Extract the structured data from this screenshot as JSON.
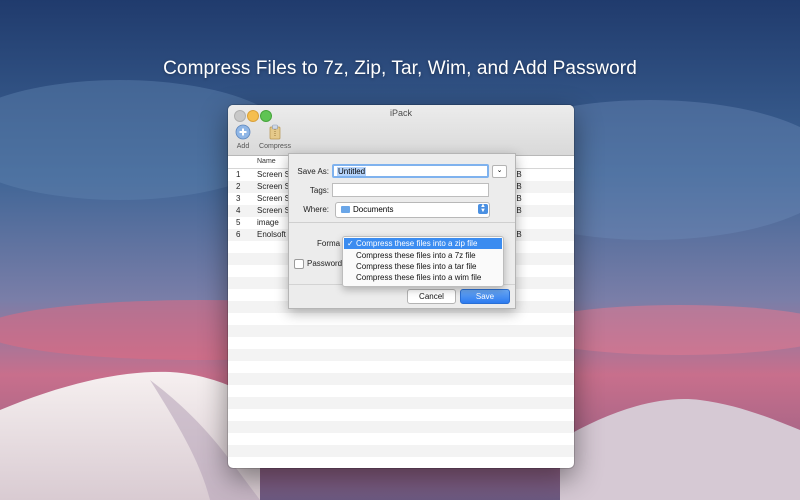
{
  "headline": "Compress Files to 7z, Zip, Tar, Wim, and Add Password",
  "window": {
    "title": "iPack",
    "toolbar": {
      "add_label": "Add",
      "compress_label": "Compress"
    },
    "list": {
      "column_name": "Name",
      "rows": [
        {
          "index": "1",
          "name": "Screen S",
          "size": "KB"
        },
        {
          "index": "2",
          "name": "Screen S",
          "size": "KB"
        },
        {
          "index": "3",
          "name": "Screen S",
          "size": "KB"
        },
        {
          "index": "4",
          "name": "Screen S",
          "size": "KB"
        },
        {
          "index": "5",
          "name": "image",
          "size": ""
        },
        {
          "index": "6",
          "name": "Enolsoft",
          "size": "KB"
        }
      ]
    }
  },
  "save_dialog": {
    "save_as_label": "Save As:",
    "save_as_value": "Untitled",
    "tags_label": "Tags:",
    "tags_value": "",
    "where_label": "Where:",
    "where_value": "Documents",
    "format_label": "Forma",
    "password_label": "Password",
    "cancel_label": "Cancel",
    "save_label": "Save"
  },
  "format_menu": {
    "selected_index": 0,
    "check_glyph": "✓",
    "options": [
      "Compress these files into a zip file",
      "Compress these files into a 7z file",
      "Compress these files into a tar file",
      "Compress these files into a wim file"
    ]
  },
  "colors": {
    "accent": "#3b8cf0",
    "sky_top": "#1e3a6e",
    "sunset": "#d85a76"
  }
}
